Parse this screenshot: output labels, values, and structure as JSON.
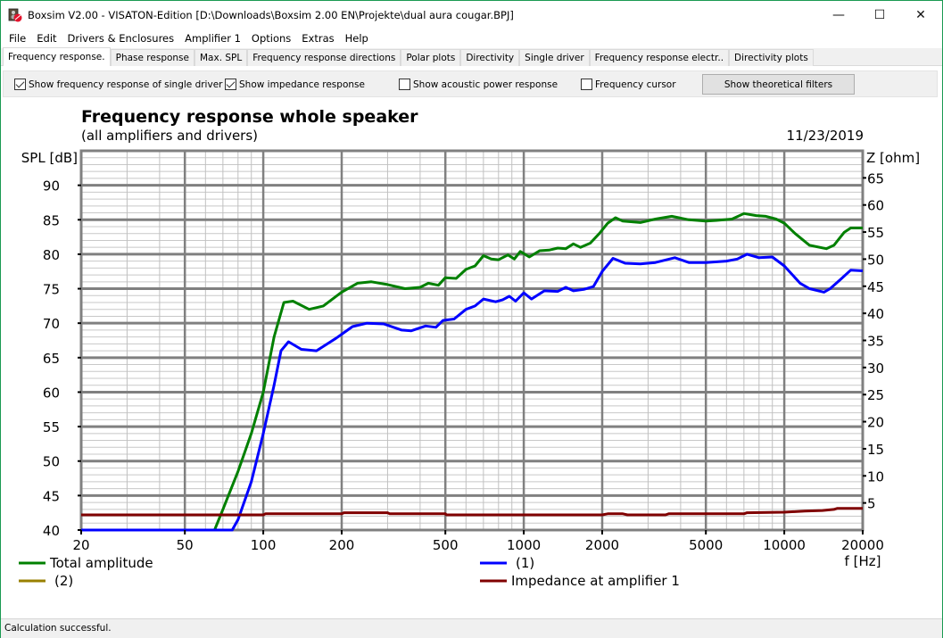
{
  "window": {
    "title": "Boxsim V2.00 - VISATON-Edition [D:\\Downloads\\Boxsim 2.00 EN\\Projekte\\dual aura cougar.BPJ]",
    "minimize_label": "—",
    "maximize_label": "☐",
    "close_label": "✕"
  },
  "menu": [
    "File",
    "Edit",
    "Drivers & Enclosures",
    "Amplifier 1",
    "Options",
    "Extras",
    "Help"
  ],
  "tabs": [
    {
      "label": "Frequency response.",
      "active": true
    },
    {
      "label": "Phase response",
      "active": false
    },
    {
      "label": "Max. SPL",
      "active": false
    },
    {
      "label": "Frequency response directions",
      "active": false
    },
    {
      "label": "Polar plots",
      "active": false
    },
    {
      "label": "Directivity",
      "active": false
    },
    {
      "label": "Single driver",
      "active": false
    },
    {
      "label": "Frequency response electr..",
      "active": false
    },
    {
      "label": "Directivity plots",
      "active": false
    }
  ],
  "toolbar": {
    "checkboxes": [
      {
        "label": "Show frequency response of single driver",
        "checked": true
      },
      {
        "label": "Show impedance response",
        "checked": true
      },
      {
        "label": "Show acoustic power response",
        "checked": false
      },
      {
        "label": "Frequency cursor",
        "checked": false
      }
    ],
    "button_label": "Show theoretical filters"
  },
  "status": "Calculation successful.",
  "chart_data": {
    "type": "line",
    "title": "Frequency response whole speaker",
    "subtitle": "(all amplifiers and drivers)",
    "date": "11/23/2019",
    "xlabel": "f [Hz]",
    "ylabel": "SPL [dB]",
    "y2label": "Z [ohm]",
    "xscale": "log",
    "xlim": [
      20,
      20000
    ],
    "ylim": [
      40,
      95
    ],
    "y2lim": [
      0,
      70
    ],
    "x_ticks": [
      20,
      50,
      100,
      200,
      500,
      1000,
      2000,
      5000,
      10000,
      20000
    ],
    "x_tick_labels": [
      "20",
      "50",
      "100",
      "200",
      "500",
      "1000",
      "2000",
      "5000",
      "10000",
      "20000"
    ],
    "y_ticks": [
      40,
      45,
      50,
      55,
      60,
      65,
      70,
      75,
      80,
      85,
      90
    ],
    "y2_ticks": [
      5,
      10,
      15,
      20,
      25,
      30,
      35,
      40,
      45,
      50,
      55,
      60,
      65
    ],
    "grid": true,
    "legend_position": "bottom",
    "series": [
      {
        "name": "Total amplitude",
        "axis": "left",
        "color": "#008000",
        "points": [
          [
            20,
            40
          ],
          [
            65,
            40
          ],
          [
            70,
            43
          ],
          [
            80,
            48.5
          ],
          [
            90,
            54
          ],
          [
            100,
            60
          ],
          [
            110,
            68
          ],
          [
            120,
            73
          ],
          [
            130,
            73.2
          ],
          [
            150,
            72
          ],
          [
            170,
            72.5
          ],
          [
            200,
            74.5
          ],
          [
            230,
            75.8
          ],
          [
            260,
            76
          ],
          [
            300,
            75.6
          ],
          [
            350,
            75
          ],
          [
            400,
            75.2
          ],
          [
            430,
            75.8
          ],
          [
            470,
            75.5
          ],
          [
            500,
            76.6
          ],
          [
            550,
            76.5
          ],
          [
            600,
            77.8
          ],
          [
            650,
            78.3
          ],
          [
            700,
            79.8
          ],
          [
            750,
            79.3
          ],
          [
            800,
            79.2
          ],
          [
            870,
            79.9
          ],
          [
            920,
            79.3
          ],
          [
            970,
            80.4
          ],
          [
            1050,
            79.6
          ],
          [
            1150,
            80.5
          ],
          [
            1250,
            80.6
          ],
          [
            1350,
            80.9
          ],
          [
            1450,
            80.8
          ],
          [
            1550,
            81.5
          ],
          [
            1650,
            81
          ],
          [
            1800,
            81.6
          ],
          [
            1950,
            83
          ],
          [
            2100,
            84.5
          ],
          [
            2250,
            85.3
          ],
          [
            2400,
            84.8
          ],
          [
            2800,
            84.6
          ],
          [
            3200,
            85.1
          ],
          [
            3700,
            85.5
          ],
          [
            4300,
            85
          ],
          [
            5000,
            84.8
          ],
          [
            5500,
            84.9
          ],
          [
            6300,
            85.1
          ],
          [
            7000,
            85.9
          ],
          [
            7800,
            85.6
          ],
          [
            8500,
            85.5
          ],
          [
            9300,
            85.1
          ],
          [
            10000,
            84.5
          ],
          [
            11000,
            83
          ],
          [
            12500,
            81.3
          ],
          [
            14500,
            80.8
          ],
          [
            15500,
            81.3
          ],
          [
            17000,
            83.2
          ],
          [
            18000,
            83.8
          ],
          [
            20000,
            83.8
          ]
        ]
      },
      {
        "name": "(1)",
        "axis": "left",
        "color": "#0000ff",
        "points": [
          [
            20,
            40
          ],
          [
            76,
            40
          ],
          [
            80,
            41.5
          ],
          [
            90,
            47
          ],
          [
            100,
            54
          ],
          [
            110,
            61
          ],
          [
            117,
            66
          ],
          [
            125,
            67.3
          ],
          [
            140,
            66.2
          ],
          [
            160,
            66
          ],
          [
            190,
            67.8
          ],
          [
            220,
            69.5
          ],
          [
            250,
            70
          ],
          [
            290,
            69.9
          ],
          [
            340,
            69
          ],
          [
            370,
            68.9
          ],
          [
            420,
            69.6
          ],
          [
            460,
            69.4
          ],
          [
            490,
            70.4
          ],
          [
            540,
            70.6
          ],
          [
            600,
            72
          ],
          [
            650,
            72.5
          ],
          [
            700,
            73.5
          ],
          [
            780,
            73.1
          ],
          [
            830,
            73.4
          ],
          [
            880,
            73.9
          ],
          [
            930,
            73.2
          ],
          [
            1000,
            74.4
          ],
          [
            1070,
            73.5
          ],
          [
            1200,
            74.7
          ],
          [
            1350,
            74.6
          ],
          [
            1450,
            75.2
          ],
          [
            1550,
            74.7
          ],
          [
            1700,
            74.9
          ],
          [
            1850,
            75.3
          ],
          [
            2000,
            77.5
          ],
          [
            2200,
            79.4
          ],
          [
            2450,
            78.7
          ],
          [
            2800,
            78.6
          ],
          [
            3200,
            78.8
          ],
          [
            3800,
            79.5
          ],
          [
            4300,
            78.8
          ],
          [
            5000,
            78.8
          ],
          [
            6000,
            79
          ],
          [
            6600,
            79.3
          ],
          [
            7200,
            80
          ],
          [
            8000,
            79.5
          ],
          [
            9000,
            79.6
          ],
          [
            10000,
            78.3
          ],
          [
            11500,
            75.8
          ],
          [
            12500,
            75
          ],
          [
            14200,
            74.5
          ],
          [
            15000,
            75
          ],
          [
            16500,
            76.4
          ],
          [
            18000,
            77.7
          ],
          [
            20000,
            77.6
          ]
        ]
      },
      {
        "name": "(2)",
        "axis": "left",
        "color": "#998000",
        "points": []
      },
      {
        "name": "Impedance at amplifier 1",
        "axis": "right",
        "color": "#800000",
        "points": [
          [
            20,
            2.8
          ],
          [
            100,
            2.8
          ],
          [
            102,
            3.0
          ],
          [
            200,
            3.0
          ],
          [
            204,
            3.2
          ],
          [
            300,
            3.2
          ],
          [
            306,
            3.0
          ],
          [
            500,
            3.0
          ],
          [
            505,
            2.8
          ],
          [
            2000,
            2.8
          ],
          [
            2100,
            3.0
          ],
          [
            2400,
            3.0
          ],
          [
            2500,
            2.8
          ],
          [
            3500,
            2.8
          ],
          [
            3600,
            3.0
          ],
          [
            7000,
            3.0
          ],
          [
            7200,
            3.2
          ],
          [
            10000,
            3.3
          ],
          [
            12000,
            3.5
          ],
          [
            14000,
            3.6
          ],
          [
            15500,
            3.8
          ],
          [
            16000,
            4.0
          ],
          [
            20000,
            4.0
          ]
        ]
      }
    ]
  }
}
